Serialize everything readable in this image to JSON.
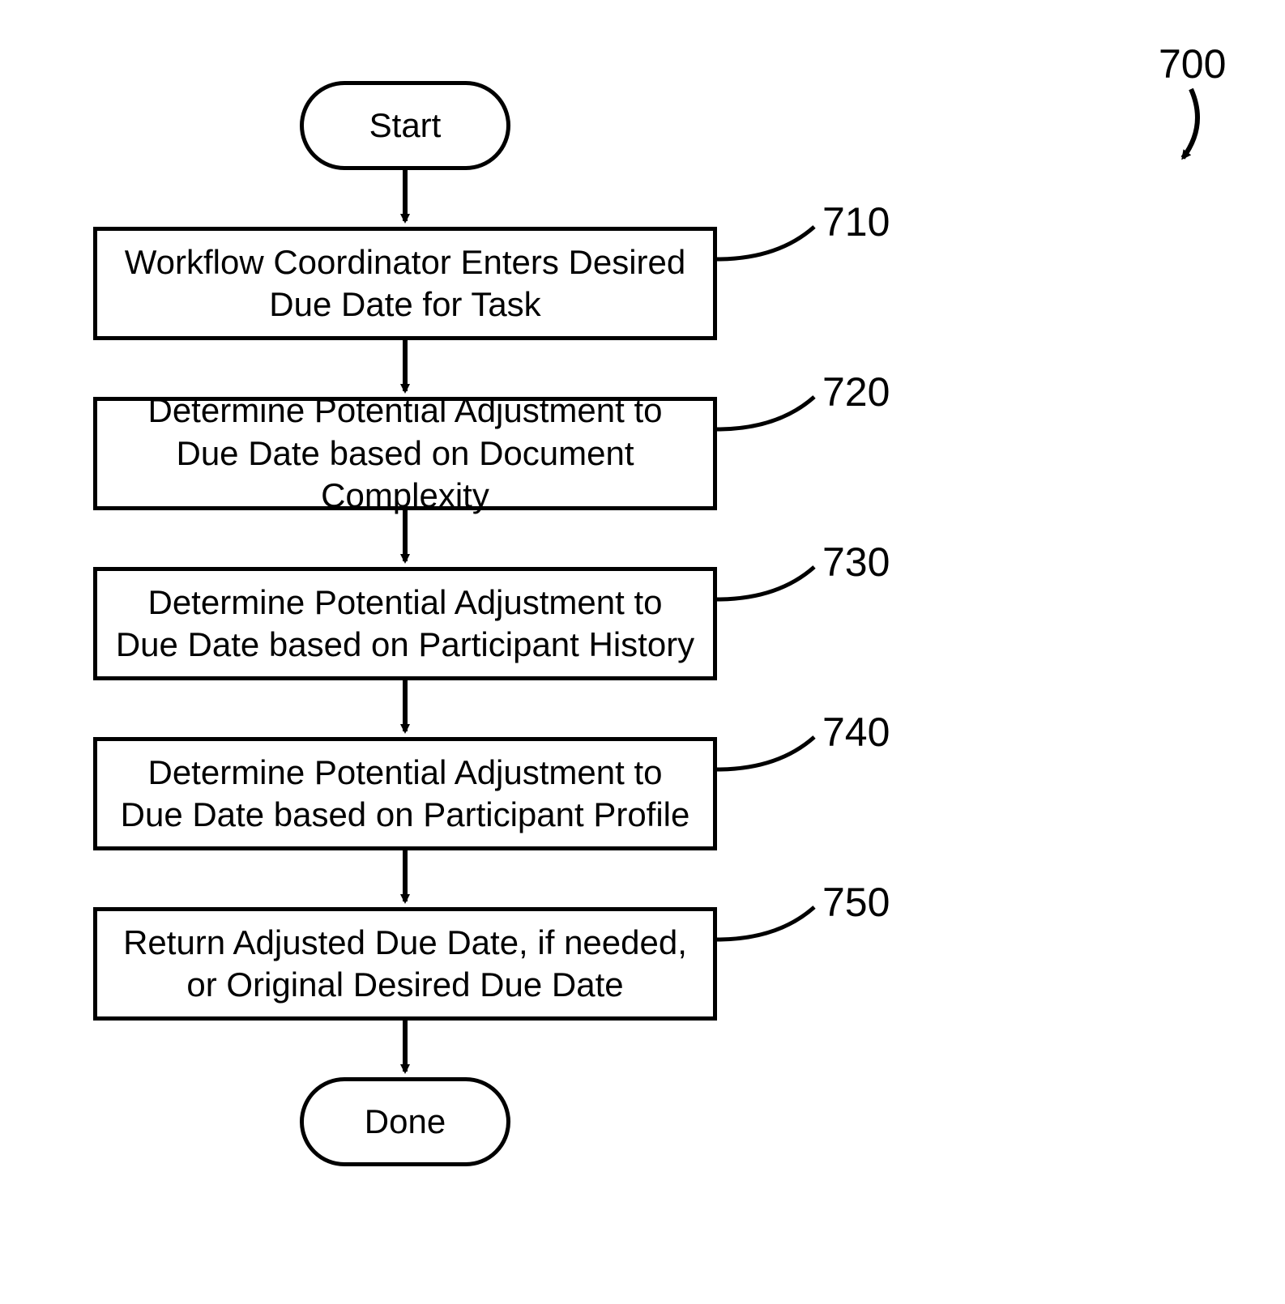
{
  "figure_ref": "700",
  "terminators": {
    "start": "Start",
    "done": "Done"
  },
  "steps": [
    {
      "ref": "710",
      "text": "Workflow Coordinator Enters Desired Due Date for Task"
    },
    {
      "ref": "720",
      "text": "Determine Potential Adjustment to Due Date based on Document Complexity"
    },
    {
      "ref": "730",
      "text": "Determine Potential Adjustment to Due Date based on Participant History"
    },
    {
      "ref": "740",
      "text": "Determine Potential Adjustment to Due Date based on Participant Profile"
    },
    {
      "ref": "750",
      "text": "Return Adjusted Due Date, if needed, or Original Desired Due Date"
    }
  ]
}
